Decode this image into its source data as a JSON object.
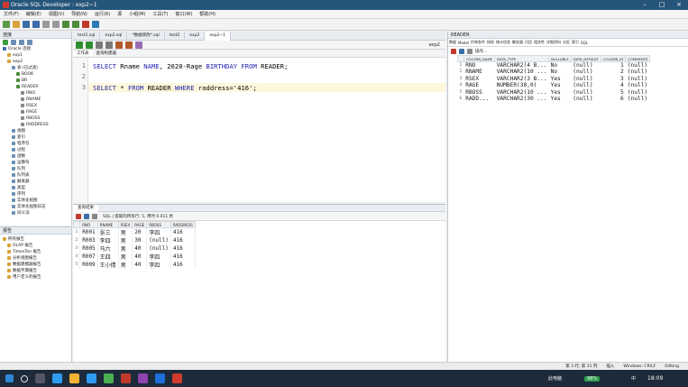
{
  "window": {
    "title": "Oracle SQL Developer : exp2~1"
  },
  "menu": [
    "文件(F)",
    "编辑(E)",
    "视图(V)",
    "导航(N)",
    "运行(R)",
    "源",
    "小组(M)",
    "工具(T)",
    "窗口(W)",
    "帮助(H)"
  ],
  "connections": {
    "panel_title": "连接",
    "tree": [
      {
        "label": "Oracle 连接",
        "level": 0
      },
      {
        "label": "exp1",
        "level": 1
      },
      {
        "label": "exp2",
        "level": 1
      },
      {
        "label": "表 (已过滤)",
        "level": 2
      },
      {
        "label": "BOOK",
        "level": 3
      },
      {
        "label": "BR",
        "level": 3
      },
      {
        "label": "READER",
        "level": 3
      },
      {
        "label": "RNO",
        "level": 4
      },
      {
        "label": "RNAME",
        "level": 4
      },
      {
        "label": "RSEX",
        "level": 4
      },
      {
        "label": "RAGE",
        "level": 4
      },
      {
        "label": "RBOSS",
        "level": 4
      },
      {
        "label": "RADDRESS",
        "level": 4
      },
      {
        "label": "视图",
        "level": 2
      },
      {
        "label": "索引",
        "level": 2
      },
      {
        "label": "程序包",
        "level": 2
      },
      {
        "label": "过程",
        "level": 2
      },
      {
        "label": "函数",
        "level": 2
      },
      {
        "label": "运算符",
        "level": 2
      },
      {
        "label": "队列",
        "level": 2
      },
      {
        "label": "队列表",
        "level": 2
      },
      {
        "label": "触发器",
        "level": 2
      },
      {
        "label": "类型",
        "level": 2
      },
      {
        "label": "序列",
        "level": 2
      },
      {
        "label": "实体化视图",
        "level": 2
      },
      {
        "label": "实体化视图日志",
        "level": 2
      },
      {
        "label": "同义词",
        "level": 2
      }
    ]
  },
  "reports": {
    "panel_title": "报告",
    "items": [
      "所有报告",
      "OLAP 报告",
      "TimesTen 报告",
      "分析视图报告",
      "数据建模器报告",
      "数据字典报告",
      "用户定义的报告"
    ]
  },
  "editor": {
    "tabs": [
      "test1.sql",
      "exp2.sql",
      "*数据修改*.sql",
      "test2",
      "exp2",
      "exp2~1"
    ],
    "active_tab": "exp2~1",
    "conn_label": "exp2",
    "subtabs": [
      "工作表",
      "查询构建器"
    ],
    "lines": [
      {
        "n": "1",
        "parts": [
          [
            "kw",
            "SELECT"
          ],
          [
            "t",
            " Rname "
          ],
          [
            "kw",
            "NAME"
          ],
          [
            "t",
            ", 2020-Rage "
          ],
          [
            "kw",
            "BIRTHDAY"
          ],
          [
            "t",
            " "
          ],
          [
            "kw",
            "FROM"
          ],
          [
            "t",
            " READER;"
          ]
        ]
      },
      {
        "n": "2",
        "parts": []
      },
      {
        "n": "3",
        "parts": [
          [
            "kw",
            "SELECT"
          ],
          [
            "t",
            " * "
          ],
          [
            "kw",
            "FROM"
          ],
          [
            "t",
            " READER "
          ],
          [
            "kw",
            "WHERE"
          ],
          [
            "t",
            " raddress='416';"
          ]
        ]
      }
    ]
  },
  "results": {
    "tab": "查询结果",
    "info": "SQL  |  提取的所有行: 5, 用时 0.011 秒",
    "columns": [
      "RNO",
      "RNAME",
      "RSEX",
      "RAGE",
      "RBOSS",
      "RADDRESS"
    ],
    "rows": [
      [
        "1",
        "R001",
        "张三",
        "男",
        "20",
        "李四",
        "416"
      ],
      [
        "2",
        "R003",
        "李四",
        "男",
        "30",
        "(null)",
        "416"
      ],
      [
        "3",
        "R005",
        "马六",
        "男",
        "40",
        "(null)",
        "416"
      ],
      [
        "4",
        "R007",
        "王四",
        "男",
        "40",
        "李四",
        "416"
      ],
      [
        "5",
        "R009",
        "王小倩",
        "男",
        "40",
        "李四",
        "416"
      ]
    ]
  },
  "right_panel": {
    "title": "READER",
    "subtabs": [
      "数据",
      "Model",
      "约束条件",
      "授权",
      "统计信息",
      "触发器",
      "闪回",
      "相关性",
      "详细资料",
      "分区",
      "索引",
      "SQL"
    ],
    "actions_label": "操作...",
    "columns": [
      "COLUMN_NAME",
      "DATA_TYPE",
      "NULLABLE",
      "DATA_DEFAULT",
      "COLUMN_ID",
      "COMMENTS"
    ],
    "rows": [
      [
        "1",
        "RNO",
        "VARCHAR2(4 B...",
        "No",
        "(null)",
        "1",
        "(null)"
      ],
      [
        "2",
        "RNAME",
        "VARCHAR2(10 ...",
        "No",
        "(null)",
        "2",
        "(null)"
      ],
      [
        "3",
        "RSEX",
        "VARCHAR2(3 B...",
        "Yes",
        "(null)",
        "3",
        "(null)"
      ],
      [
        "4",
        "RAGE",
        "NUMBER(38,0)",
        "Yes",
        "(null)",
        "4",
        "(null)"
      ],
      [
        "5",
        "RBOSS",
        "VARCHAR2(10 ...",
        "Yes",
        "(null)",
        "5",
        "(null)"
      ],
      [
        "6",
        "RADD...",
        "VARCHAR2(30 ...",
        "Yes",
        "(null)",
        "6",
        "(null)"
      ]
    ]
  },
  "status": {
    "cursor": "第 3 行, 第 31 列",
    "mode": "插入",
    "line_end": "Windows: CR/LF",
    "editing": "Editing"
  },
  "taskbar": {
    "time": "18:09",
    "battery": "98%",
    "tray_label": "此电脑",
    "lang": "中"
  }
}
